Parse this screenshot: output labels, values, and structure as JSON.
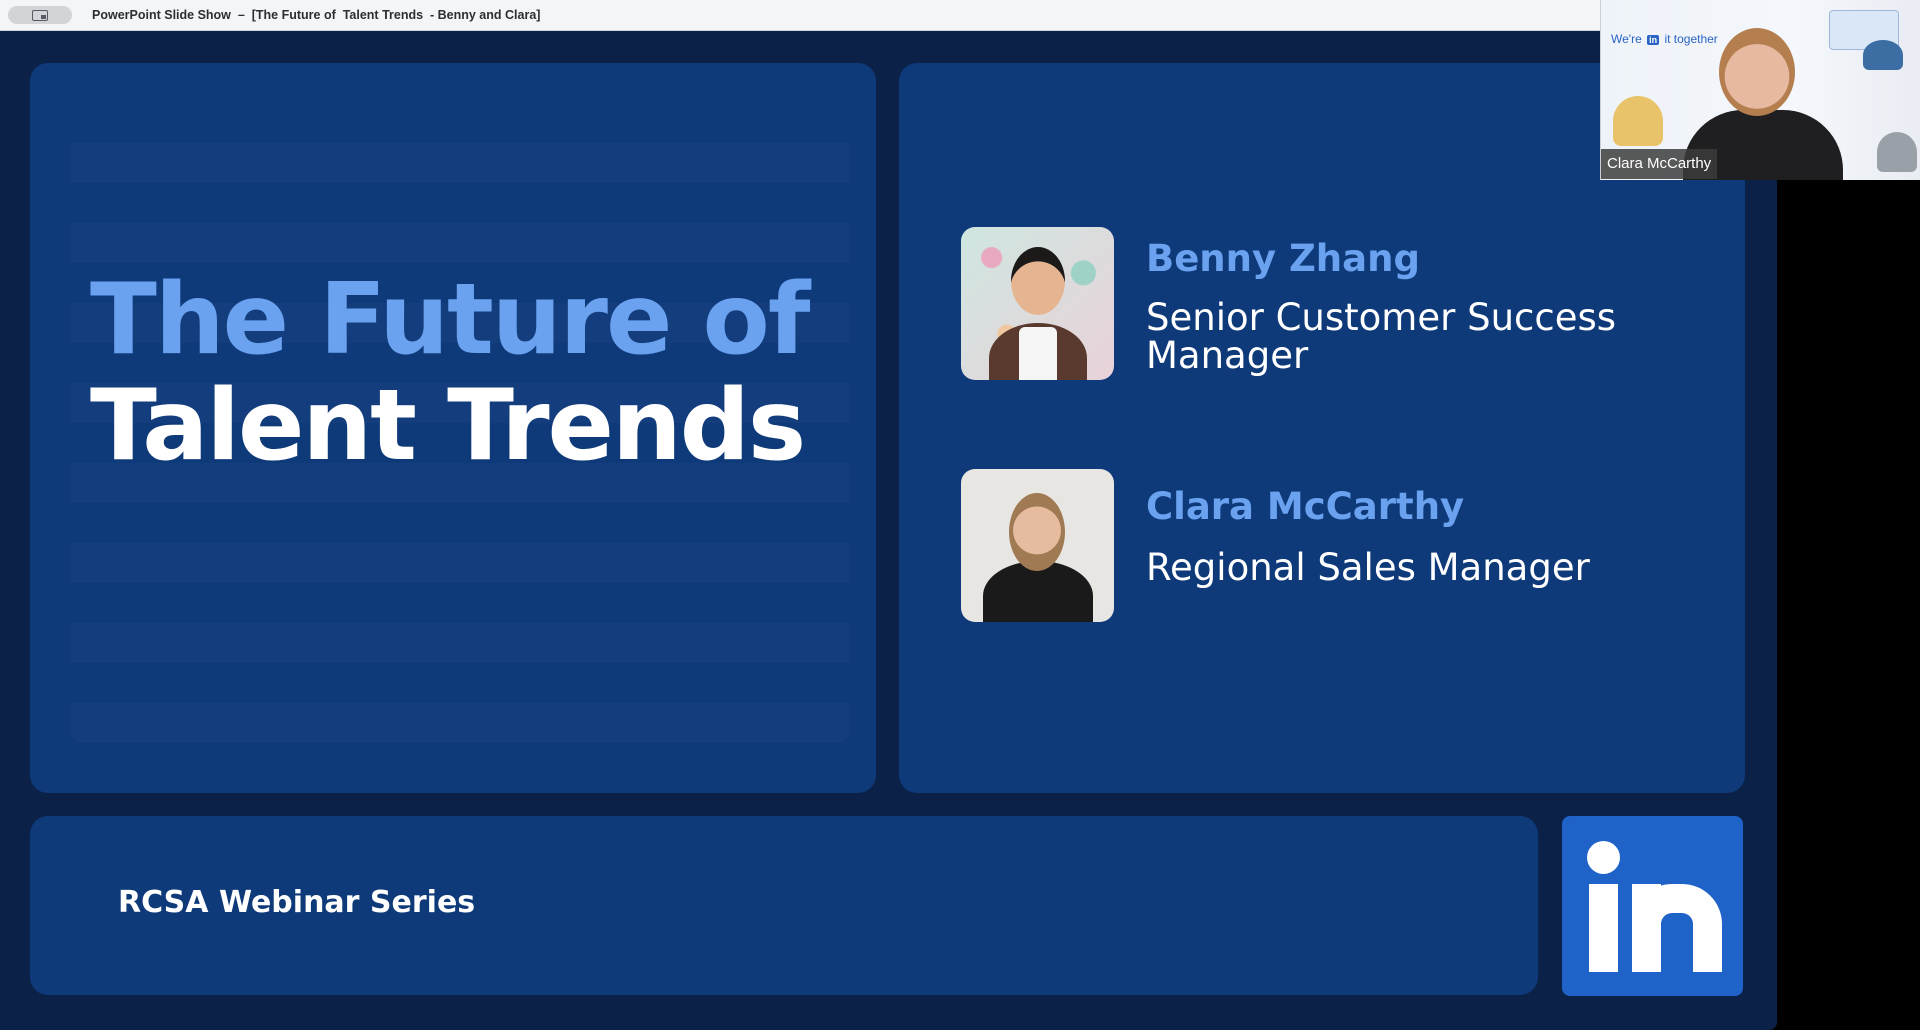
{
  "window": {
    "title": "PowerPoint Slide Show  –  [The Future of  Talent Trends  - Benny and Clara]"
  },
  "slide": {
    "title_line_1": "The Future of",
    "title_line_2": "Talent Trends",
    "speakers": [
      {
        "name": "Benny Zhang",
        "role": "Senior Customer Success Manager"
      },
      {
        "name": "Clara McCarthy",
        "role": "Regional Sales Manager"
      }
    ],
    "footer": "RCSA Webinar Series",
    "logo": "in"
  },
  "video": {
    "banner_pre": "We're",
    "banner_badge": "in",
    "banner_post": "it together",
    "participant_name": "Clara McCarthy"
  },
  "colors": {
    "slide_bg": "#0b2148",
    "panel_bg": "#0f3a7a",
    "accent_blue": "#6aa2f0",
    "logo_blue": "#1f63c9"
  },
  "icons": [
    "window-switch-icon",
    "linkedin-logo-icon"
  ]
}
